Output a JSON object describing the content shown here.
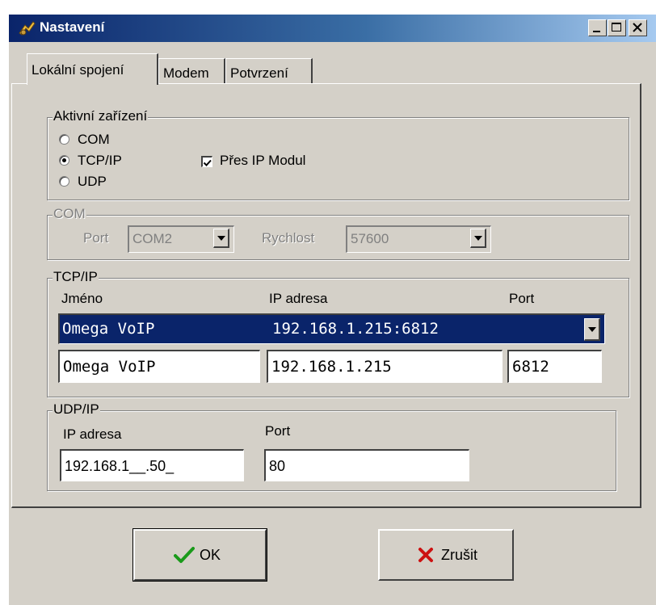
{
  "window": {
    "title": "Nastavení"
  },
  "tabs": [
    {
      "label": "Lokální spojení",
      "active": true
    },
    {
      "label": "Modem",
      "active": false
    },
    {
      "label": "Potvrzení",
      "active": false
    }
  ],
  "aktivni": {
    "legend": "Aktivní zařízení",
    "options": [
      "COM",
      "TCP/IP",
      "UDP"
    ],
    "selected": "TCP/IP",
    "checkbox_label": "Přes IP Modul",
    "checkbox_checked": true
  },
  "com": {
    "legend": "COM",
    "port_label": "Port",
    "port_value": "COM2",
    "rychlost_label": "Rychlost",
    "rychlost_value": "57600"
  },
  "tcpip": {
    "legend": "TCP/IP",
    "col_name": "Jméno",
    "col_ip": "IP adresa",
    "col_port": "Port",
    "selected_name": "Omega VoIP",
    "selected_addr": "192.168.1.215:6812",
    "name_value": "Omega VoIP",
    "ip_value": "192.168.1.215",
    "port_value": "6812"
  },
  "udpip": {
    "legend": "UDP/IP",
    "ip_label": "IP adresa",
    "port_label": "Port",
    "ip_value": "192.168.1__.50_",
    "port_value": "80"
  },
  "buttons": {
    "ok": "OK",
    "cancel": "Zrušit"
  },
  "colors": {
    "titlebar_start": "#0a246a",
    "titlebar_end": "#a6caf0",
    "selection": "#0a246a",
    "face": "#d4d0c8",
    "ok_check": "#1a9a1a",
    "cancel_x": "#cc1111"
  },
  "icons": [
    "app-icon",
    "minimize-icon",
    "maximize-icon",
    "close-icon",
    "chevron-down-icon",
    "checkmark-icon",
    "cross-icon"
  ]
}
